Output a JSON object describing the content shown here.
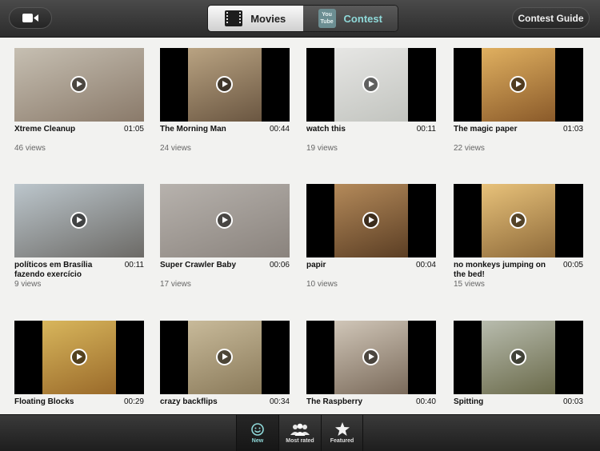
{
  "header": {
    "movies_label": "Movies",
    "contest_label": "Contest",
    "youtube_top": "You",
    "youtube_bottom": "Tube",
    "guide_label": "Contest Guide"
  },
  "videos": [
    {
      "title": "Xtreme Cleanup",
      "duration": "01:05",
      "views": "46 views",
      "colors": [
        "#c6bfb2",
        "#8a7a6a"
      ],
      "bars": false
    },
    {
      "title": "The Morning Man",
      "duration": "00:44",
      "views": "24 views",
      "colors": [
        "#b9a382",
        "#6a5641"
      ],
      "bars": true
    },
    {
      "title": "watch this",
      "duration": "00:11",
      "views": "19 views",
      "colors": [
        "#e6e6e4",
        "#c2c4bf"
      ],
      "bars": true
    },
    {
      "title": "The magic paper",
      "duration": "01:03",
      "views": "22 views",
      "colors": [
        "#e0b060",
        "#8a5a2a"
      ],
      "bars": true
    },
    {
      "title": "políticos em Brasília fazendo exercício",
      "duration": "00:11",
      "views": "9 views",
      "colors": [
        "#bcc6cc",
        "#6c6a66"
      ],
      "bars": false
    },
    {
      "title": "Super Crawler Baby",
      "duration": "00:06",
      "views": "17 views",
      "colors": [
        "#b7b2ad",
        "#8a837d"
      ],
      "bars": false
    },
    {
      "title": "papir",
      "duration": "00:04",
      "views": "10 views",
      "colors": [
        "#b48a5a",
        "#5b3e24"
      ],
      "bars": true
    },
    {
      "title": "no monkeys jumping on the bed!",
      "duration": "00:05",
      "views": "15 views",
      "colors": [
        "#e8c27a",
        "#8e6a3a"
      ],
      "bars": true
    },
    {
      "title": "Floating Blocks",
      "duration": "00:29",
      "views": "",
      "colors": [
        "#d8b65c",
        "#9a6a2a"
      ],
      "bars": true
    },
    {
      "title": "crazy backflips",
      "duration": "00:34",
      "views": "",
      "colors": [
        "#c8ba9a",
        "#8a7a5a"
      ],
      "bars": true
    },
    {
      "title": "The Raspberry",
      "duration": "00:40",
      "views": "",
      "colors": [
        "#d0c6b8",
        "#7a6a5a"
      ],
      "bars": true
    },
    {
      "title": "Spitting",
      "duration": "00:03",
      "views": "",
      "colors": [
        "#b8bcae",
        "#6a6a4a"
      ],
      "bars": true
    }
  ],
  "tabs": [
    {
      "label": "New"
    },
    {
      "label": "Most rated"
    },
    {
      "label": "Featured"
    }
  ]
}
